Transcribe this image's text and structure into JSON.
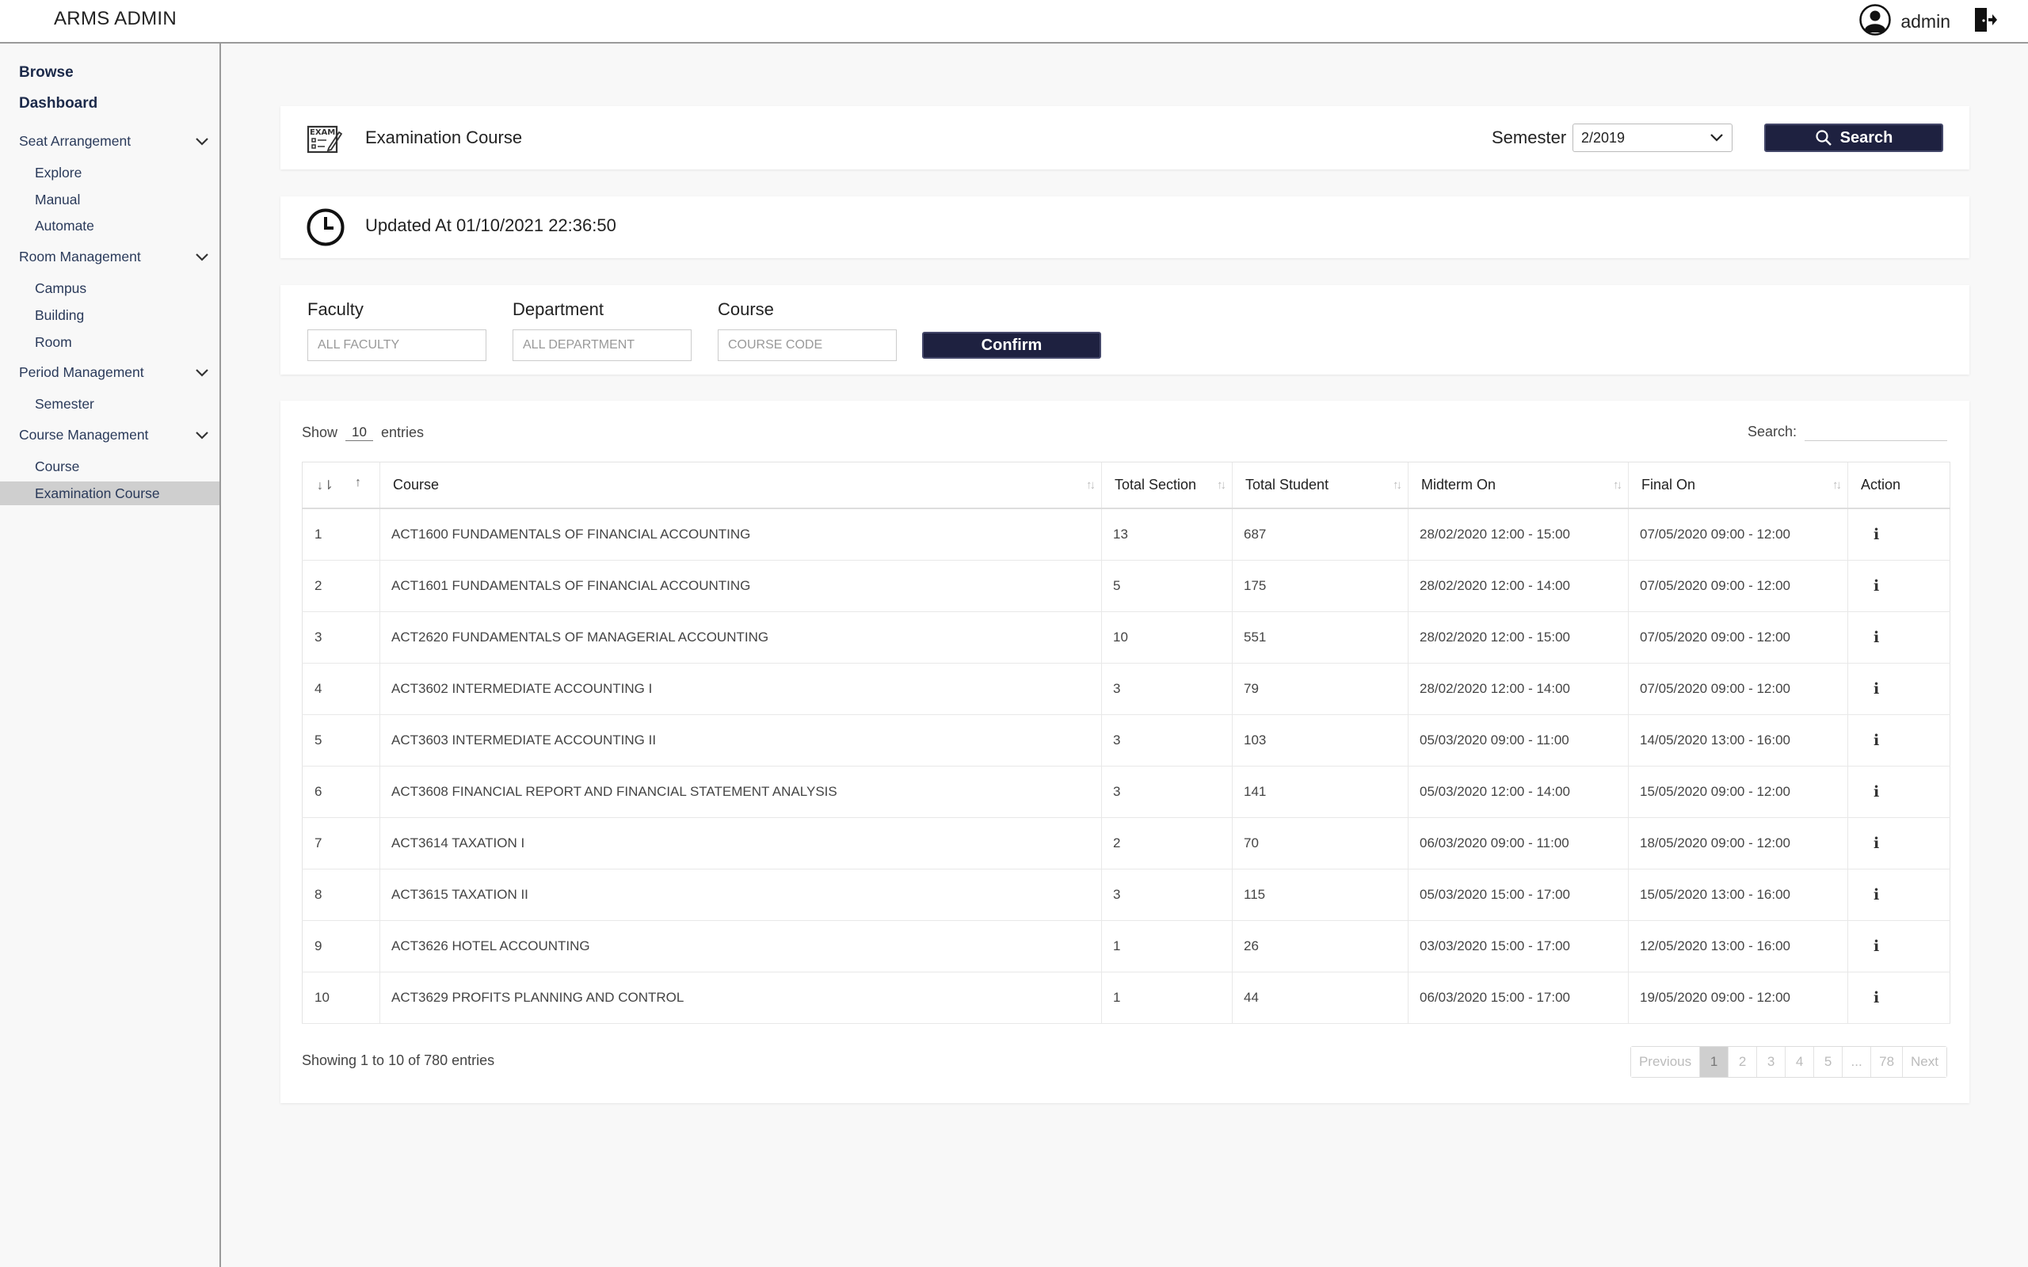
{
  "app": {
    "brand": "ARMS ADMIN",
    "user": "admin"
  },
  "sidebar": {
    "browse": "Browse",
    "dashboard": "Dashboard",
    "seat_group": "Seat Arrangement",
    "seat_items": [
      "Explore",
      "Manual",
      "Automate"
    ],
    "room_group": "Room Management",
    "room_items": [
      "Campus",
      "Building",
      "Room"
    ],
    "period_group": "Period Management",
    "period_items": [
      "Semester"
    ],
    "course_group": "Course Management",
    "course_items": [
      "Course",
      "Examination Course"
    ],
    "active_item": "Examination Course"
  },
  "header_panel": {
    "title": "Examination Course",
    "semester_label": "Semester",
    "semester_value": "2/2019",
    "search_button": "Search"
  },
  "updated": {
    "text": "Updated At 01/10/2021 22:36:50"
  },
  "filters": {
    "faculty_label": "Faculty",
    "faculty_placeholder": "ALL FACULTY",
    "department_label": "Department",
    "department_placeholder": "ALL DEPARTMENT",
    "course_label": "Course",
    "course_placeholder": "COURSE CODE",
    "confirm_button": "Confirm"
  },
  "table": {
    "show_label": "Show",
    "entries_value": "10",
    "entries_label": "entries",
    "search_label": "Search:",
    "columns": [
      "",
      "Course",
      "Total Section",
      "Total Student",
      "Midterm On",
      "Final On",
      "Action"
    ],
    "rows": [
      {
        "no": "1",
        "course": "ACT1600 FUNDAMENTALS OF FINANCIAL ACCOUNTING",
        "sections": "13",
        "students": "687",
        "midterm": "28/02/2020 12:00 - 15:00",
        "final": "07/05/2020 09:00 - 12:00"
      },
      {
        "no": "2",
        "course": "ACT1601 FUNDAMENTALS OF FINANCIAL ACCOUNTING",
        "sections": "5",
        "students": "175",
        "midterm": "28/02/2020 12:00 - 14:00",
        "final": "07/05/2020 09:00 - 12:00"
      },
      {
        "no": "3",
        "course": "ACT2620 FUNDAMENTALS OF MANAGERIAL ACCOUNTING",
        "sections": "10",
        "students": "551",
        "midterm": "28/02/2020 12:00 - 15:00",
        "final": "07/05/2020 09:00 - 12:00"
      },
      {
        "no": "4",
        "course": "ACT3602 INTERMEDIATE ACCOUNTING I",
        "sections": "3",
        "students": "79",
        "midterm": "28/02/2020 12:00 - 14:00",
        "final": "07/05/2020 09:00 - 12:00"
      },
      {
        "no": "5",
        "course": "ACT3603 INTERMEDIATE ACCOUNTING II",
        "sections": "3",
        "students": "103",
        "midterm": "05/03/2020 09:00 - 11:00",
        "final": "14/05/2020 13:00 - 16:00"
      },
      {
        "no": "6",
        "course": "ACT3608 FINANCIAL REPORT AND FINANCIAL STATEMENT ANALYSIS",
        "sections": "3",
        "students": "141",
        "midterm": "05/03/2020 12:00 - 14:00",
        "final": "15/05/2020 09:00 - 12:00"
      },
      {
        "no": "7",
        "course": "ACT3614 TAXATION I",
        "sections": "2",
        "students": "70",
        "midterm": "06/03/2020 09:00 - 11:00",
        "final": "18/05/2020 09:00 - 12:00"
      },
      {
        "no": "8",
        "course": "ACT3615 TAXATION II",
        "sections": "3",
        "students": "115",
        "midterm": "05/03/2020 15:00 - 17:00",
        "final": "15/05/2020 13:00 - 16:00"
      },
      {
        "no": "9",
        "course": "ACT3626 HOTEL ACCOUNTING",
        "sections": "1",
        "students": "26",
        "midterm": "03/03/2020 15:00 - 17:00",
        "final": "12/05/2020 13:00 - 16:00"
      },
      {
        "no": "10",
        "course": "ACT3629 PROFITS PLANNING AND CONTROL",
        "sections": "1",
        "students": "44",
        "midterm": "06/03/2020 15:00 - 17:00",
        "final": "19/05/2020 09:00 - 12:00"
      }
    ],
    "action_icon": "info-icon",
    "showing_text": "Showing 1 to 10 of 780 entries",
    "pagination": [
      "Previous",
      "1",
      "2",
      "3",
      "4",
      "5",
      "...",
      "78",
      "Next"
    ],
    "current_page": "1"
  }
}
